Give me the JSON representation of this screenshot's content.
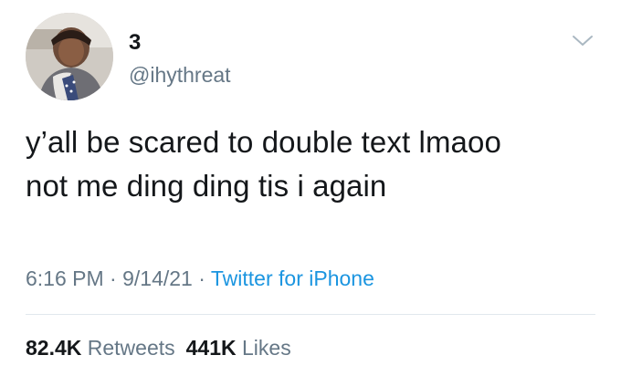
{
  "author": {
    "display_name": "3",
    "handle": "@ihythreat",
    "avatar_icon": "profile-photo"
  },
  "menu_icon": "chevron-down-icon",
  "tweet": {
    "text_lines": [
      "y’all be scared to double text lmaoo",
      "not me ding ding tis i again"
    ]
  },
  "meta": {
    "time": "6:16 PM",
    "sep1": " · ",
    "date": "9/14/21",
    "sep2": " · ",
    "source": "Twitter for iPhone"
  },
  "stats": {
    "retweets_count": "82.4K",
    "retweets_label": "Retweets",
    "likes_count": "441K",
    "likes_label": "Likes"
  },
  "colors": {
    "text": "#14171a",
    "secondary": "#657786",
    "link": "#1b95e0",
    "divider": "#e1e8ed"
  }
}
